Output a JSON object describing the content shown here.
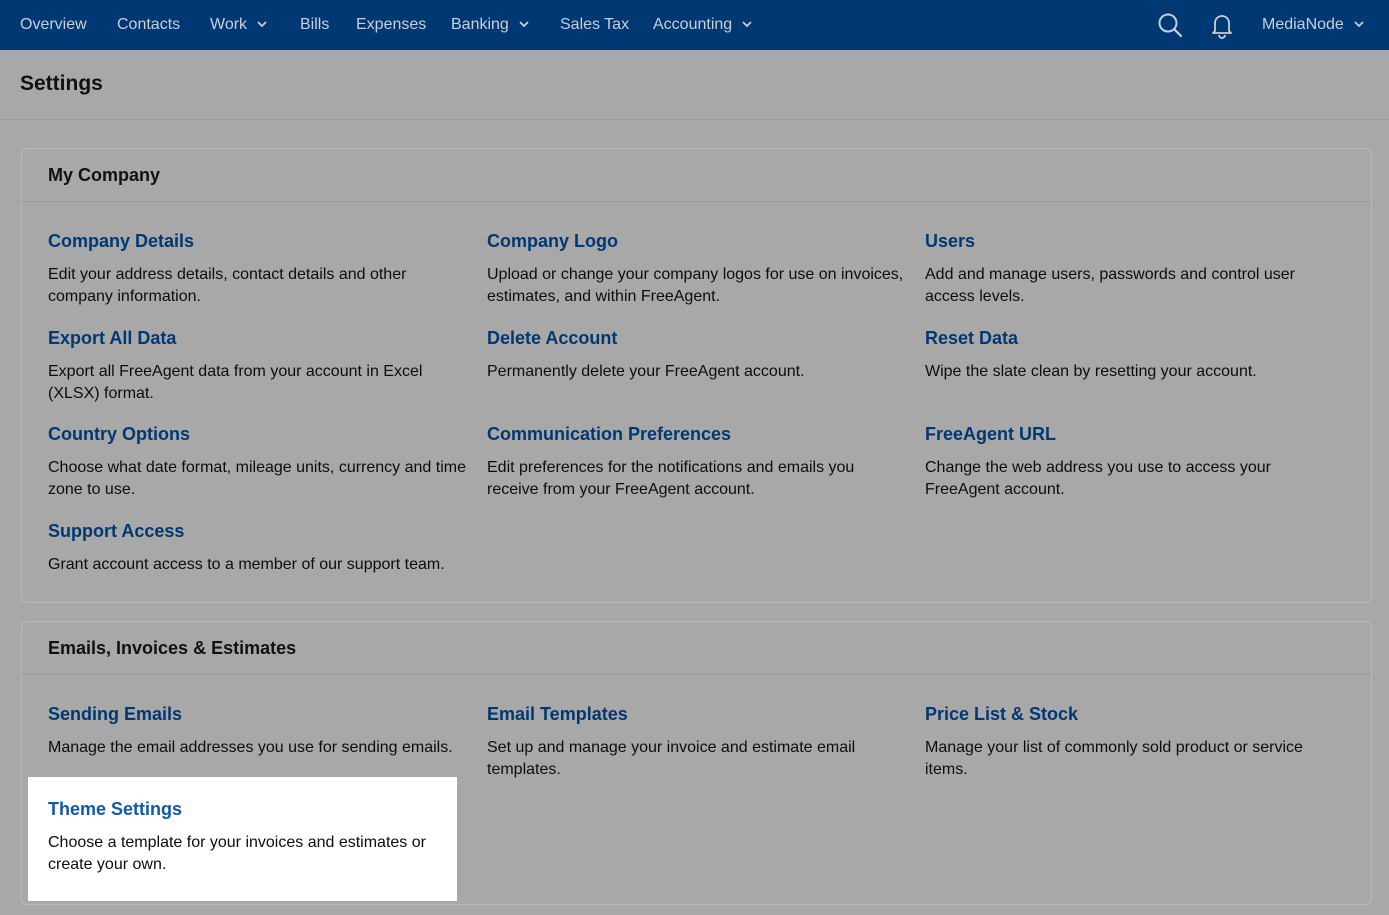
{
  "nav": {
    "items": [
      {
        "label": "Overview",
        "dropdown": false
      },
      {
        "label": "Contacts",
        "dropdown": false
      },
      {
        "label": "Work",
        "dropdown": true
      },
      {
        "label": "Bills",
        "dropdown": false
      },
      {
        "label": "Expenses",
        "dropdown": false
      },
      {
        "label": "Banking",
        "dropdown": true
      },
      {
        "label": "Sales Tax",
        "dropdown": false
      },
      {
        "label": "Accounting",
        "dropdown": true
      }
    ],
    "search_icon": "search-icon",
    "notifications_icon": "bell-icon",
    "account_label": "MediaNode"
  },
  "header": {
    "title": "Settings"
  },
  "sections": [
    {
      "title": "My Company",
      "items": [
        {
          "title": "Company Details",
          "desc": "Edit your address details, contact details and other company information."
        },
        {
          "title": "Company Logo",
          "desc": "Upload or change your company logos for use on invoices, estimates, and within FreeAgent."
        },
        {
          "title": "Users",
          "desc": "Add and manage users, passwords and control user access levels."
        },
        {
          "title": "Export All Data",
          "desc": "Export all FreeAgent data from your account in Excel (XLSX) format."
        },
        {
          "title": "Delete Account",
          "desc": "Permanently delete your FreeAgent account."
        },
        {
          "title": "Reset Data",
          "desc": "Wipe the slate clean by resetting your account."
        },
        {
          "title": "Country Options",
          "desc": "Choose what date format, mileage units, currency and time zone to use."
        },
        {
          "title": "Communication Preferences",
          "desc": "Edit preferences for the notifications and emails you receive from your FreeAgent account."
        },
        {
          "title": "FreeAgent URL",
          "desc": "Change the web address you use to access your FreeAgent account."
        },
        {
          "title": "Support Access",
          "desc": "Grant account access to a member of our support team."
        }
      ]
    },
    {
      "title": "Emails, Invoices & Estimates",
      "items": [
        {
          "title": "Sending Emails",
          "desc": "Manage the email addresses you use for sending emails."
        },
        {
          "title": "Email Templates",
          "desc": "Set up and manage your invoice and estimate email templates."
        },
        {
          "title": "Price List & Stock",
          "desc": "Manage your list of commonly sold product or service items."
        },
        {
          "title": "Theme Settings",
          "desc": "Choose a template for your invoices and estimates or create your own."
        }
      ]
    }
  ],
  "colors": {
    "nav_bg": "#003874",
    "link": "#003874",
    "highlight_link": "#0f5ba6",
    "overlay_bg": "#a8a8a8"
  }
}
